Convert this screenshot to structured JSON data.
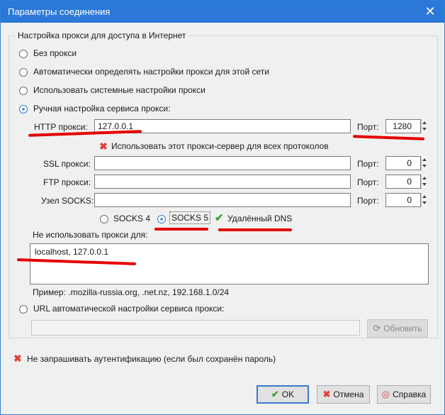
{
  "window": {
    "title": "Параметры соединения",
    "close_glyph": "✕"
  },
  "group_title": "Настройка прокси для доступа в Интернет",
  "options": {
    "no_proxy": "Без прокси",
    "auto_detect": "Автоматически определять настройки прокси для этой сети",
    "system": "Использовать системные настройки прокси",
    "manual": "Ручная настройка сервиса прокси:",
    "pac": "URL автоматической настройки сервиса прокси:"
  },
  "selected_option": "manual",
  "http": {
    "label": "HTTP прокси:",
    "value": "127.0.0.1",
    "port_label": "Порт:",
    "port": "1280"
  },
  "same_for_all": {
    "label": "Использовать этот прокси-сервер для всех протоколов",
    "checked": false,
    "icon": "x-mark-icon"
  },
  "ssl": {
    "label": "SSL прокси:",
    "value": "",
    "port_label": "Порт:",
    "port": "0"
  },
  "ftp": {
    "label": "FTP прокси:",
    "value": "",
    "port_label": "Порт:",
    "port": "0"
  },
  "socks": {
    "label": "Узел SOCKS:",
    "value": "",
    "port_label": "Порт:",
    "port": "0"
  },
  "socks_version": {
    "v4": "SOCKS 4",
    "v5": "SOCKS 5",
    "selected": "v5"
  },
  "remote_dns": {
    "label": "Удалённый DNS",
    "checked": true,
    "icon": "check-mark-icon"
  },
  "no_proxy_for": {
    "label": "Не использовать прокси для:",
    "value": "localhost, 127.0.0.1"
  },
  "example": "Пример: .mozilla-russia.org, .net.nz, 192.168.1.0/24",
  "pac_url": {
    "value": "",
    "reload_label": "Обновить",
    "icon": "reload-icon"
  },
  "no_auth_prompt": {
    "label": "Не запрашивать аутентификацию (если был сохранён пароль)",
    "checked": false,
    "icon": "x-mark-icon"
  },
  "buttons": {
    "ok": "OK",
    "cancel": "Отмена",
    "help": "Справка"
  },
  "colors": {
    "titlebar": "#2b78d8",
    "annotation_marker": "#e30000",
    "check_green": "#3aa33a",
    "x_red": "#e0403a"
  }
}
